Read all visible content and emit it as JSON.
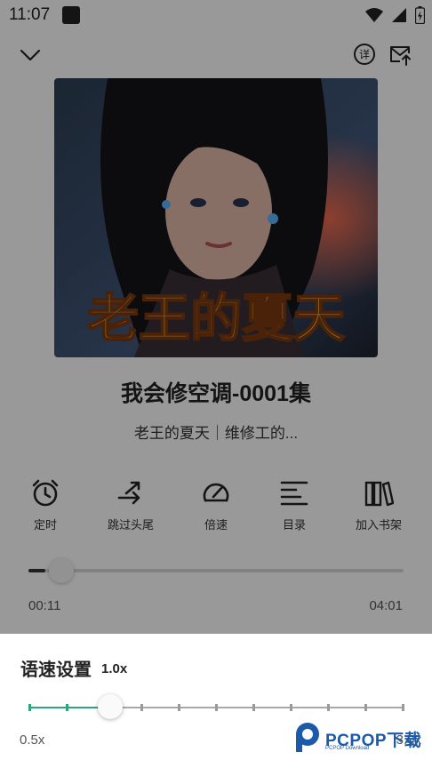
{
  "status_bar": {
    "time": "11:07"
  },
  "player": {
    "cover_title": "老王的夏天",
    "episode_title": "我会修空调-0001集",
    "subtitle": "老王的夏天｜维修工的...",
    "controls": [
      {
        "icon": "alarm-clock-icon",
        "label": "定时"
      },
      {
        "icon": "skip-arrows-icon",
        "label": "跳过头尾"
      },
      {
        "icon": "speedometer-icon",
        "label": "倍速"
      },
      {
        "icon": "list-icon",
        "label": "目录"
      },
      {
        "icon": "bookshelf-icon",
        "label": "加入书架"
      }
    ],
    "current_time": "00:11",
    "total_time": "04:01",
    "progress": 0.045
  },
  "speed_sheet": {
    "title": "语速设置",
    "value": "1.0x",
    "min_label": "0.5x",
    "max_label": "3.0x",
    "steps": 11,
    "selected_index": 2
  },
  "watermark": {
    "brand": "PCPOP下载",
    "tagline": "PCPOP Download"
  },
  "colors": {
    "accent": "#2aa77a",
    "overlay": "rgba(0,0,0,0.4)",
    "watermark": "#1a5aa8"
  }
}
